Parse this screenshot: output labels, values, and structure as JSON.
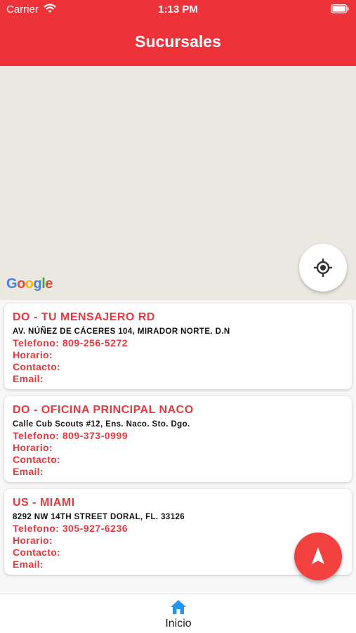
{
  "status": {
    "carrier": "Carrier",
    "time": "1:13 PM"
  },
  "header": {
    "title": "Sucursales"
  },
  "map": {
    "logo_text": "Google"
  },
  "branches": [
    {
      "name": "DO - TU MENSAJERO RD",
      "address": "AV. NÚÑEZ DE CÁCERES 104, MIRADOR NORTE. D.N",
      "phone": "Telefono: 809-256-5272",
      "horario": "Horario:",
      "contacto": "Contacto:",
      "email": "Email:"
    },
    {
      "name": "DO - OFICINA PRINCIPAL NACO",
      "address": "Calle Cub Scouts #12, Ens. Naco. Sto. Dgo.",
      "phone": "Telefono: 809-373-0999",
      "horario": "Horario:",
      "contacto": "Contacto:",
      "email": "Email:"
    },
    {
      "name": "US - MIAMI",
      "address": "8292 NW 14TH STREET  DORAL, FL. 33126",
      "phone": "Telefono: 305-927-6236",
      "horario": "Horario:",
      "contacto": "Contacto:",
      "email": "Email:"
    }
  ],
  "tabs": [
    {
      "label": "Inicio",
      "icon": "home-icon"
    }
  ],
  "colors": {
    "accent": "#ee3239",
    "fab": "#f2413e",
    "tab_active": "#2196f3",
    "map_bg": "#ebe8e1"
  }
}
